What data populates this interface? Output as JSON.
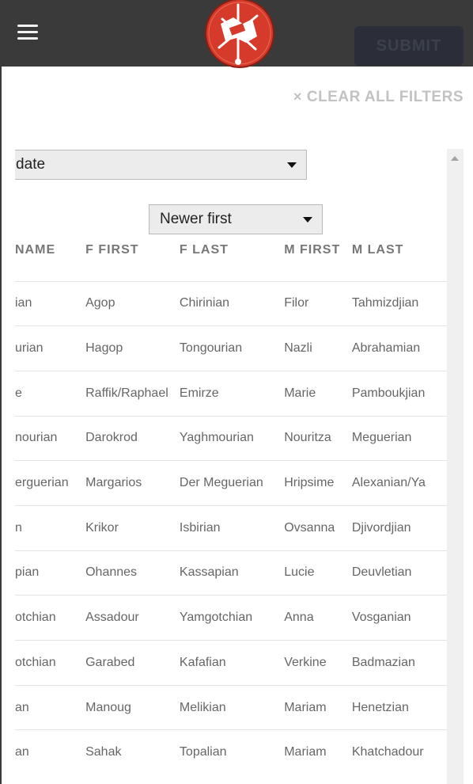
{
  "header": {
    "submit_label": "SUBMIT"
  },
  "filters": {
    "clear_label": "CLEAR ALL FILTERS",
    "clear_icon": "×"
  },
  "sort": {
    "field_visible_text": "st date",
    "order_value": "Newer first"
  },
  "table": {
    "headers": [
      "NAME",
      "F FIRST",
      "F LAST",
      "M FIRST",
      "M LAST"
    ],
    "rows": [
      [
        "ian",
        "Agop",
        "Chirinian",
        "Filor",
        "Tahmizdjian"
      ],
      [
        "urian",
        "Hagop",
        "Tongourian",
        "Nazli",
        "Abrahamian"
      ],
      [
        "e",
        "Raffik/Raphael",
        "Emirze",
        "Marie",
        "Pamboukjian"
      ],
      [
        "nourian",
        "Darokrod",
        "Yaghmourian",
        "Nouritza",
        "Meguerian"
      ],
      [
        "erguerian",
        "Margarios",
        "Der Meguerian",
        "Hripsime",
        "Alexanian/Ya"
      ],
      [
        "n",
        "Krikor",
        "Isbirian",
        "Ovsanna",
        "Djivordjian"
      ],
      [
        "pian",
        "Ohannes",
        "Kassapian",
        "Lucie",
        "Deuvletian"
      ],
      [
        "otchian",
        "Assadour",
        "Yamgotchian",
        "Anna",
        "Vosganian"
      ],
      [
        "otchian",
        "Garabed",
        "Kafafian",
        "Verkine",
        "Badmazian"
      ],
      [
        "an",
        "Manoug",
        "Melikian",
        "Mariam",
        "Henetzian"
      ],
      [
        "an",
        "Sahak",
        "Topalian",
        "Mariam",
        "Khatchadour"
      ]
    ]
  },
  "colors": {
    "topbar": "#3a3a3a",
    "logo_red": "#d63a2a",
    "submit_bg": "#2b2e38",
    "clear_filters": "#c2c2c2"
  }
}
